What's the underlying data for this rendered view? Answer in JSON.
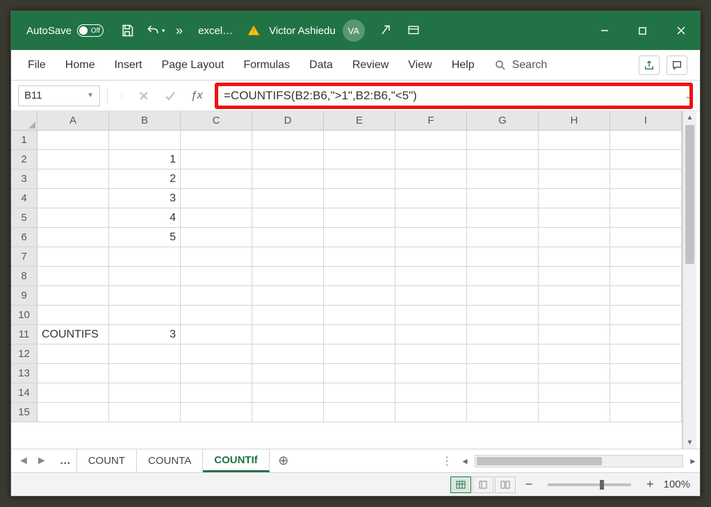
{
  "titlebar": {
    "autosave_label": "AutoSave",
    "autosave_state": "Off",
    "filename": "excel…",
    "username": "Victor Ashiedu",
    "avatar_initials": "VA"
  },
  "ribbon": {
    "tabs": [
      "File",
      "Home",
      "Insert",
      "Page Layout",
      "Formulas",
      "Data",
      "Review",
      "View",
      "Help"
    ],
    "search_label": "Search"
  },
  "formula_bar": {
    "cell_ref": "B11",
    "formula": "=COUNTIFS(B2:B6,\">1\",B2:B6,\"<5\")"
  },
  "grid": {
    "columns": [
      "A",
      "B",
      "C",
      "D",
      "E",
      "F",
      "G",
      "H",
      "I"
    ],
    "rows": 15,
    "cells": {
      "B2": "1",
      "B3": "2",
      "B4": "3",
      "B5": "4",
      "B6": "5",
      "A11": "COUNTIFS",
      "B11": "3"
    }
  },
  "sheets": {
    "tabs": [
      "COUNT",
      "COUNTA",
      "COUNTIf"
    ],
    "active": "COUNTIf"
  },
  "statusbar": {
    "zoom": "100%"
  },
  "chart_data": null
}
